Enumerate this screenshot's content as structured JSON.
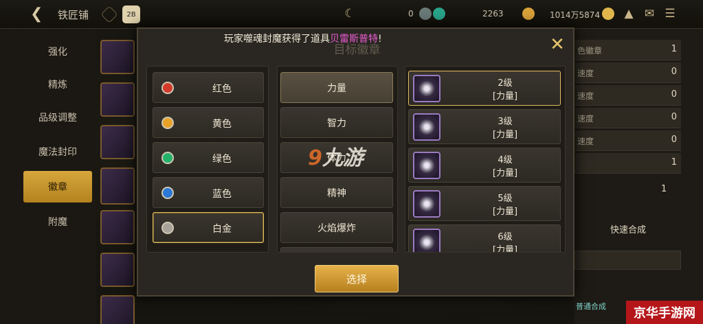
{
  "topbar": {
    "shop_title": "铁匠铺",
    "currencies": [
      {
        "value": "0"
      },
      {
        "value": "2263"
      },
      {
        "value": "1014万5874"
      }
    ]
  },
  "sidebar": {
    "items": [
      {
        "label": "强化"
      },
      {
        "label": "精炼"
      },
      {
        "label": "品级调整"
      },
      {
        "label": "魔法封印"
      },
      {
        "label": "徽章",
        "active": true
      },
      {
        "label": "附魔"
      }
    ]
  },
  "right_panel": {
    "rows": [
      {
        "label": "色徽章",
        "value": "1"
      },
      {
        "label": "速度",
        "value": "0"
      },
      {
        "label": "速度",
        "value": "0"
      },
      {
        "label": "速度",
        "value": "0"
      },
      {
        "label": "速度",
        "value": "0"
      },
      {
        "label": "",
        "value": "1"
      }
    ],
    "count": "1",
    "synth_label": "快速合成",
    "normal_synth": "普通合成"
  },
  "modal": {
    "notice_prefix": "玩家噬魂封魔获得了道具",
    "notice_item": "贝雷斯普特",
    "notice_suffix": "!",
    "title": "目标徽章",
    "colors": [
      {
        "label": "红色",
        "color": "#d23b2a"
      },
      {
        "label": "黄色",
        "color": "#e7a228"
      },
      {
        "label": "绿色",
        "color": "#23b26a"
      },
      {
        "label": "蓝色",
        "color": "#2b78d6"
      },
      {
        "label": "白金",
        "color": "#a7a39a",
        "selected": true
      }
    ],
    "stats": [
      {
        "label": "力量",
        "selected": true
      },
      {
        "label": "智力"
      },
      {
        "label": "体力"
      },
      {
        "label": "精神"
      },
      {
        "label": "火焰爆炸"
      }
    ],
    "badges": [
      {
        "level": "2级",
        "stat": "[力量]",
        "selected": true
      },
      {
        "level": "3级",
        "stat": "[力量]"
      },
      {
        "level": "4级",
        "stat": "[力量]"
      },
      {
        "level": "5级",
        "stat": "[力量]"
      },
      {
        "level": "6级",
        "stat": "[力量]"
      }
    ],
    "select_label": "选择"
  },
  "watermark": {
    "brand": "九游",
    "corner": "京华手游网"
  }
}
